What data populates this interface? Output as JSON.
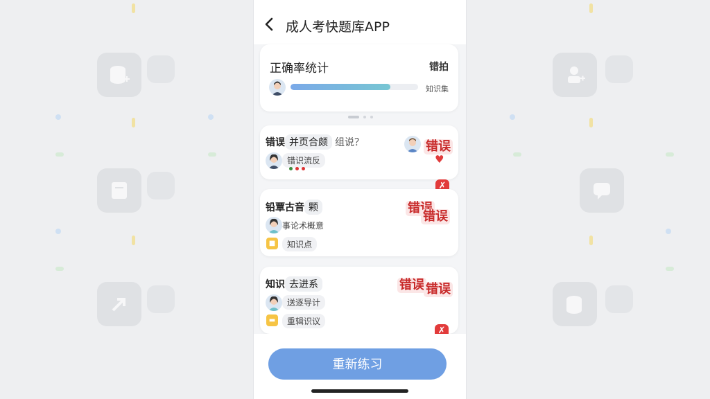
{
  "header": {
    "title": "成人考快题库APP"
  },
  "stats": {
    "title": "正确率统计",
    "right_label": "错拍",
    "side_label": "知识集",
    "progress": 0.78
  },
  "questions": [
    {
      "title_prefix": "错误",
      "title_tag": "并页合颇",
      "title_rest": "组说？",
      "chip": "错识流反",
      "wrong_label": "错误"
    },
    {
      "title_prefix": "铅覃古音",
      "title_tag": "颗",
      "chip": "事论术概意",
      "tag": "知识点",
      "wrong_label": "错误"
    },
    {
      "title_prefix": "知识",
      "title_tag": "去进系",
      "chip": "送逐导计",
      "tag": "重辑识议",
      "wrong_label": "错误"
    }
  ],
  "footer": {
    "button_label": "重新练习"
  },
  "colors": {
    "accent": "#6f9fe3",
    "wrong": "#c82a2a",
    "badge": "#e23b3b"
  }
}
